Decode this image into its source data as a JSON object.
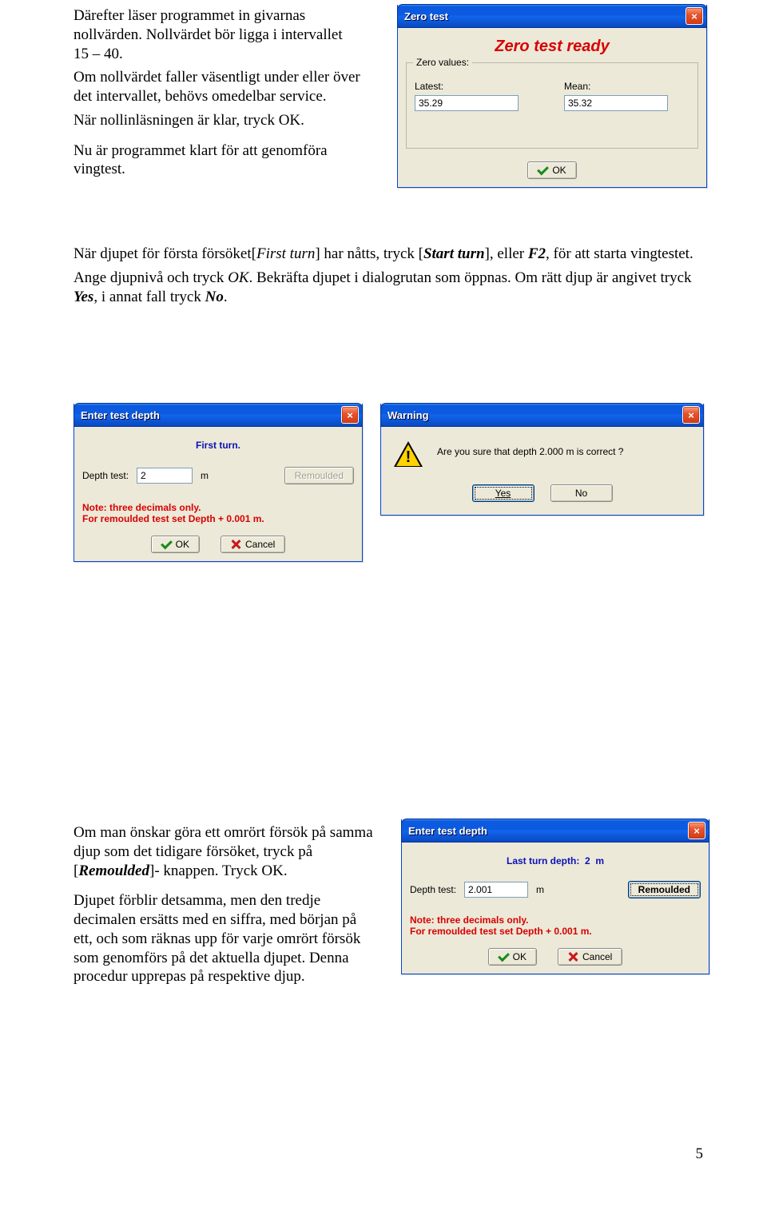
{
  "text": {
    "p1": "Därefter läser programmet in givarnas nollvärden. Nollvärdet bör ligga i intervallet 15 – 40.",
    "p2": "Om nollvärdet faller väsentligt under eller över det intervallet, behövs omedelbar service.",
    "p3": "När nollinläsningen är klar, tryck OK.",
    "p4": "Nu är programmet klart för att genomföra vingtest.",
    "p5a": "När djupet för första försöket[",
    "p5b": "First turn",
    "p5c": "] har nåtts, tryck [",
    "p5d": "Start turn",
    "p5e": "], eller ",
    "p5f": "F2",
    "p5g": ", för att starta vingtestet.",
    "p6a": "Ange djupnivå och tryck ",
    "p6b": "OK",
    "p6c": ". Bekräfta djupet i dialogrutan som öppnas. Om rätt djup är angivet tryck ",
    "p6d": "Yes",
    "p6e": ", i annat fall tryck ",
    "p6f": "No",
    "p6g": ".",
    "p7a": "Om man önskar göra ett omrört försök på samma djup som det tidigare försöket, tryck på [",
    "p7b": "Remoulded",
    "p7c": "]- knappen. Tryck OK.",
    "p8": "Djupet förblir detsamma, men den tredje decimalen ersätts med en siffra, med början på ett, och som räknas upp för varje omrört försök som genomförs på det aktuella djupet. Denna procedur upprepas på respektive djup."
  },
  "zero": {
    "title": "Zero test",
    "banner": "Zero test ready",
    "group": "Zero values:",
    "latest_label": "Latest:",
    "latest_value": "35.29",
    "mean_label": "Mean:",
    "mean_value": "35.32",
    "ok": "OK"
  },
  "depth1": {
    "title": "Enter test depth",
    "subtitle": "First turn.",
    "depth_label": "Depth test:",
    "depth_value": "2",
    "unit": "m",
    "remoulded": "Remoulded",
    "note_l1": "Note: three decimals only.",
    "note_l2": "For remoulded test set Depth + 0.001 m.",
    "ok": "OK",
    "cancel": "Cancel"
  },
  "warn": {
    "title": "Warning",
    "msg": "Are you sure that depth 2.000 m is correct ?",
    "yes": "Yes",
    "no": "No"
  },
  "depth2": {
    "title": "Enter test depth",
    "last_label": "Last turn depth:",
    "last_value": "2",
    "last_unit": "m",
    "depth_label": "Depth test:",
    "depth_value": "2.001",
    "unit": "m",
    "remoulded": "Remoulded",
    "note_l1": "Note: three decimals only.",
    "note_l2": "For remoulded test set Depth + 0.001 m.",
    "ok": "OK",
    "cancel": "Cancel"
  },
  "page_number": "5"
}
